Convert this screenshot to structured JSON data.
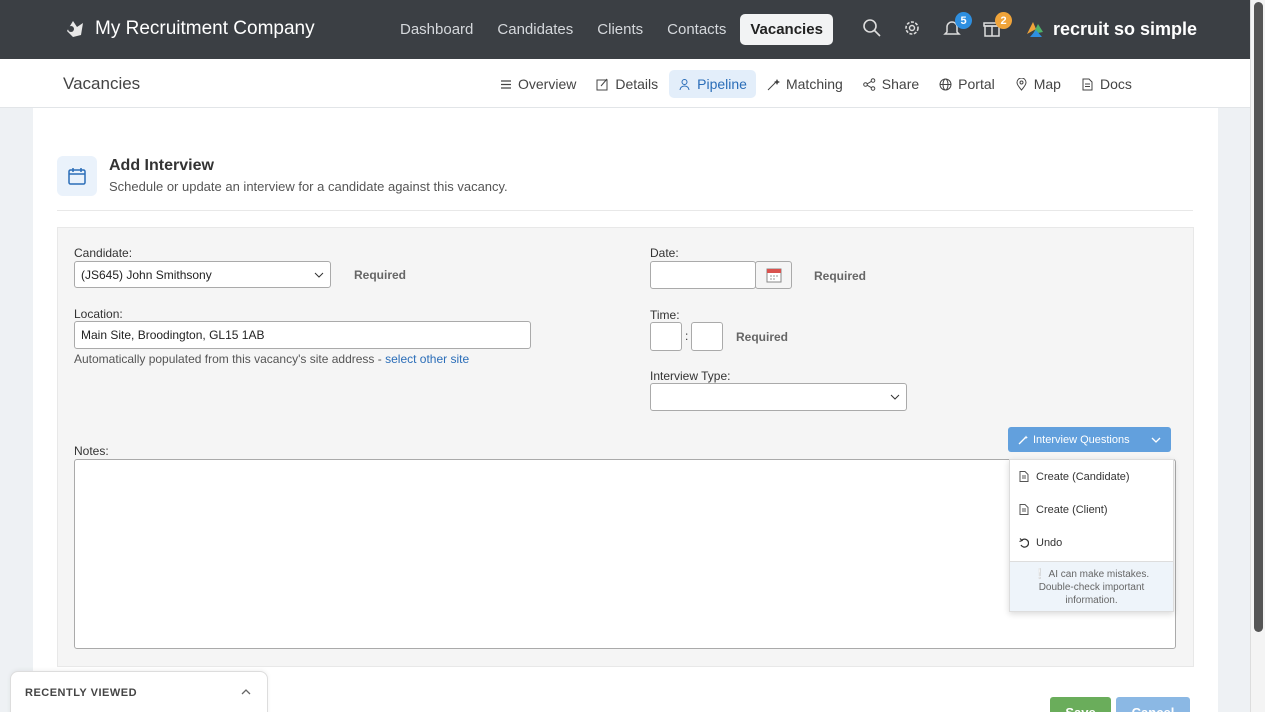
{
  "topbar": {
    "company": "My Recruitment Company",
    "nav": [
      "Dashboard",
      "Candidates",
      "Clients",
      "Contacts",
      "Vacancies"
    ],
    "active_nav": "Vacancies",
    "notifications_count": "5",
    "gifts_count": "2",
    "product_logo": "recruit so simple"
  },
  "subbar": {
    "title": "Vacancies",
    "tabs": [
      "Overview",
      "Details",
      "Pipeline",
      "Matching",
      "Share",
      "Portal",
      "Map",
      "Docs"
    ],
    "active_tab": "Pipeline"
  },
  "header": {
    "title": "Add Interview",
    "subtitle": "Schedule or update an interview for a candidate against this vacancy."
  },
  "form": {
    "candidate_label": "Candidate:",
    "candidate_value": "(JS645) John Smithsony",
    "candidate_required": "Required",
    "location_label": "Location:",
    "location_value": "Main Site, Broodington, GL15 1AB",
    "location_help": "Automatically populated from this vacancy's site address - ",
    "location_link": "select other site",
    "date_label": "Date:",
    "date_value": "",
    "date_required": "Required",
    "time_label": "Time:",
    "time_sep": ":",
    "time_required": "Required",
    "type_label": "Interview Type:",
    "type_value": "",
    "notes_label": "Notes:"
  },
  "ai": {
    "button_label": "Interview Questions",
    "items": [
      "Create (Candidate)",
      "Create (Client)",
      "Undo"
    ],
    "note": "AI can make mistakes. Double-check important information."
  },
  "recently_viewed": "RECENTLY VIEWED",
  "actions": {
    "save": "Save",
    "cancel": "Cancel"
  },
  "colors": {
    "topbar": "#3b3f44",
    "accent": "#2a6db8",
    "ai_button": "#62a0dd",
    "save": "#6aad5b",
    "cancel": "#8bb8e4"
  }
}
